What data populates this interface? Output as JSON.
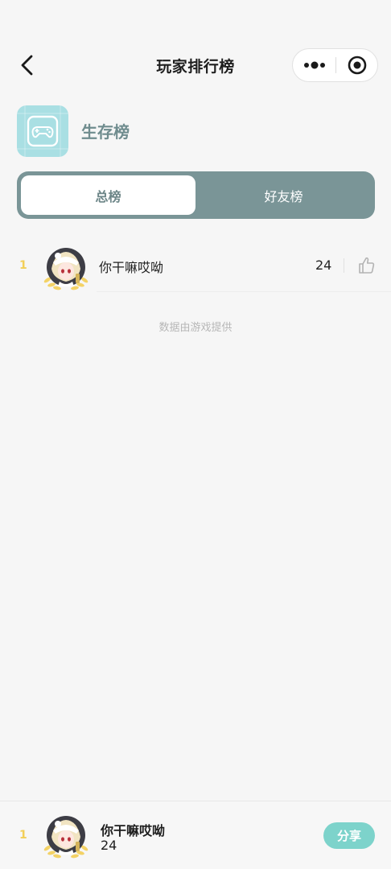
{
  "nav": {
    "title": "玩家排行榜"
  },
  "game": {
    "name": "生存榜"
  },
  "tabs": [
    {
      "label": "总榜",
      "active": true
    },
    {
      "label": "好友榜",
      "active": false
    }
  ],
  "ranking": [
    {
      "rank": "1",
      "name": "你干嘛哎呦",
      "score": "24"
    }
  ],
  "footnote": "数据由游戏提供",
  "self": {
    "rank": "1",
    "name": "你干嘛哎呦",
    "score": "24",
    "share_label": "分享"
  },
  "colors": {
    "accent": "#7dd3cb",
    "tab_bg": "#7a9597",
    "rank_gold": "#f2cf58",
    "game_icon_bg": "#a9dfe3"
  },
  "icons": {
    "back": "chevron-left-icon",
    "more": "more-dots-icon",
    "close": "target-close-icon",
    "game": "gamepad-icon",
    "like": "thumbs-up-icon",
    "laurel": "laurel-wreath-icon"
  }
}
